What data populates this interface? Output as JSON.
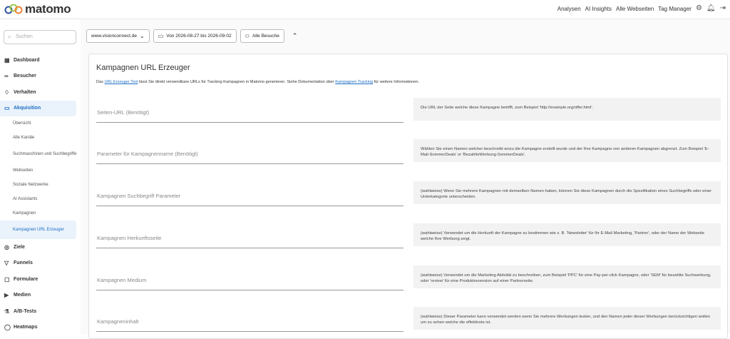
{
  "brand": {
    "name": "matomo"
  },
  "topnav": {
    "items": [
      "Analysen",
      "AI Insights",
      "Alle Webseiten",
      "Tag Manager"
    ]
  },
  "sidebar": {
    "search_placeholder": "Suchen",
    "items": [
      {
        "label": "Dashboard",
        "icon": "dashboard-icon"
      },
      {
        "label": "Besucher",
        "icon": "visitors-icon"
      },
      {
        "label": "Verhalten",
        "icon": "bell-icon"
      },
      {
        "label": "Akquisition",
        "icon": "acquisition-icon"
      }
    ],
    "subitems": [
      "Übersicht",
      "Alle Kanäle",
      "Suchmaschinen und Suchbegriffe",
      "Webseiten",
      "Soziale Netzwerke",
      "AI Assistants",
      "Kampagnen",
      "Kampagnen URL Erzeuger"
    ],
    "items2": [
      {
        "label": "Ziele",
        "icon": "target-icon"
      },
      {
        "label": "Funnels",
        "icon": "funnel-icon"
      },
      {
        "label": "Formulare",
        "icon": "form-icon"
      },
      {
        "label": "Medien",
        "icon": "media-icon"
      },
      {
        "label": "A/B-Tests",
        "icon": "flask-icon"
      },
      {
        "label": "Heatmaps",
        "icon": "heatmap-icon"
      }
    ]
  },
  "toolbar": {
    "site": "www.visionconnect.de",
    "period": "Von 2026-08-27 bis 2026-09-02",
    "segment": "Alle Besuche"
  },
  "card": {
    "title": "Kampagnen URL Erzeuger",
    "intro_before": "Das ",
    "intro_link1": "URL Erzeuger Tool",
    "intro_mid": " lässt Sie direkt verwendbare URLs für Tracking Kampagnen in Matomo generieren. Siehe Dokumentation über ",
    "intro_link2": "Kampagnen Tracking",
    "intro_after": " für weitere Informationen.",
    "fields": [
      {
        "placeholder": "Seiten-URL (Benötigt)",
        "help": "Die URL der Seite welche diese Kampagne betrifft, zum Beispiel 'http://example.org/offer.html'."
      },
      {
        "placeholder": "Parameter für Kampagnenname (Benötigt)",
        "help": "Wählen Sie einen Namen welcher beschreibt wozu die Kampagne erstellt wurde und der Ihre Kampagne von anderen Kampagnen abgrenzt. Zum Beispiel 'E-Mail-SommerDeals' or 'BezahlteWerbung-SommerDeals'."
      },
      {
        "placeholder": "Kampagnen Suchbegriff Parameter",
        "help": "(wahlweise) Wenn Sie mehrere Kampagnen mit demselben Namen haben, können Sie diese Kampagnen durch die Spezifikation eines Suchbegriffs oder einer Unterkategorie unterscheiden."
      },
      {
        "placeholder": "Kampagnen Herkunftsseite",
        "help": "(wahlweise) Verwendet um die Herkunft der Kampagne zu bestimmen wie z. B. 'Newsletter' für Ihr E-Mail Marketing, 'Partner', oder der Name der Webseite welche Ihre Werbung zeigt."
      },
      {
        "placeholder": "Kampagnen Medium",
        "help": "(wahlweise) Verwendet um die Marketing Aktivität zu beschreiben, zum Beispiel 'PPC' für eine Pay-per-click Kampagne, oder 'SEM' für bezahlte Suchwerbung, oder 'review' für eine Produktrezension auf einer Partnerseite."
      },
      {
        "placeholder": "Kampagneninhalt",
        "help": "(wahlweise) Dieser Parameter kann verwendet werden wenn Sie mehrere Werbungen testen, und den Namen jeder dieser Werbungen berücksichtigen wollen um zu sehen welche die effektivste ist."
      }
    ]
  }
}
